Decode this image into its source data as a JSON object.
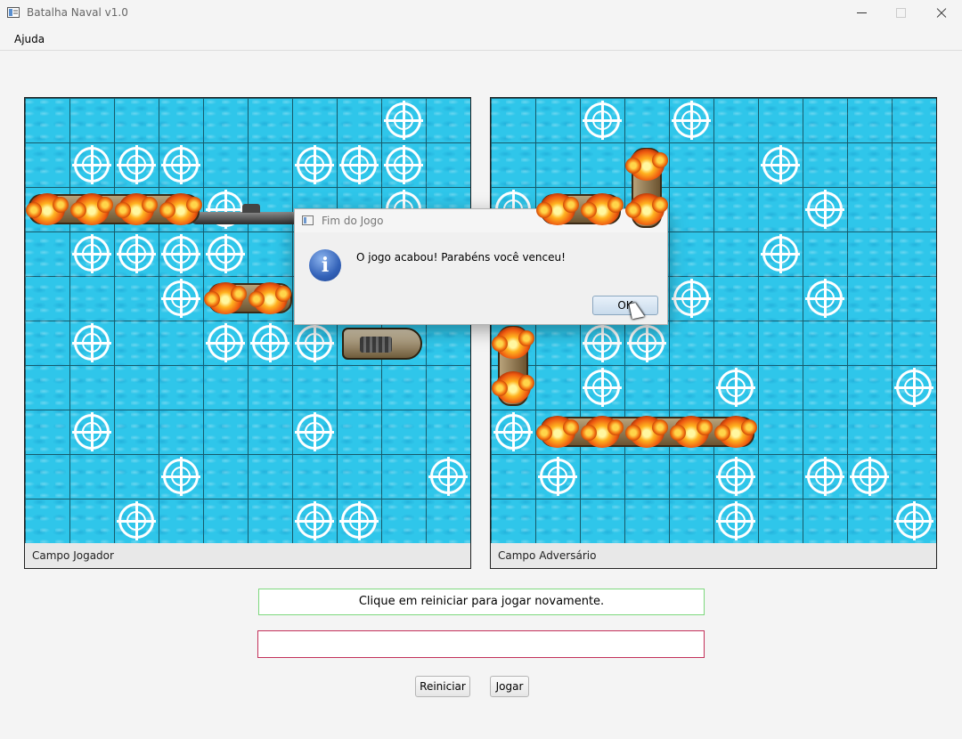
{
  "window": {
    "title": "Batalha Naval v1.0"
  },
  "menu": {
    "items": [
      "Ajuda"
    ]
  },
  "player_board": {
    "label": "Campo Jogador",
    "misses": [
      [
        0,
        8
      ],
      [
        1,
        1
      ],
      [
        1,
        2
      ],
      [
        1,
        3
      ],
      [
        1,
        6
      ],
      [
        1,
        7
      ],
      [
        1,
        8
      ],
      [
        2,
        4
      ],
      [
        2,
        8
      ],
      [
        3,
        1
      ],
      [
        3,
        2
      ],
      [
        3,
        3
      ],
      [
        3,
        4
      ],
      [
        4,
        3
      ],
      [
        5,
        1
      ],
      [
        5,
        4
      ],
      [
        5,
        5
      ],
      [
        5,
        6
      ],
      [
        7,
        1
      ],
      [
        7,
        6
      ],
      [
        8,
        3
      ],
      [
        8,
        9
      ],
      [
        9,
        2
      ],
      [
        9,
        6
      ],
      [
        9,
        7
      ]
    ],
    "hits": [
      [
        2,
        0
      ],
      [
        2,
        1
      ],
      [
        2,
        2
      ],
      [
        2,
        3
      ],
      [
        4,
        4
      ],
      [
        4,
        5
      ]
    ]
  },
  "opponent_board": {
    "label": "Campo Adversário",
    "misses": [
      [
        0,
        2
      ],
      [
        0,
        4
      ],
      [
        1,
        6
      ],
      [
        2,
        0
      ],
      [
        2,
        7
      ],
      [
        3,
        6
      ],
      [
        4,
        4
      ],
      [
        4,
        7
      ],
      [
        5,
        2
      ],
      [
        5,
        3
      ],
      [
        6,
        2
      ],
      [
        6,
        5
      ],
      [
        6,
        9
      ],
      [
        7,
        0
      ],
      [
        8,
        1
      ],
      [
        8,
        5
      ],
      [
        8,
        7
      ],
      [
        8,
        8
      ],
      [
        9,
        5
      ],
      [
        9,
        9
      ]
    ],
    "hits": [
      [
        1,
        3
      ],
      [
        2,
        1
      ],
      [
        2,
        2
      ],
      [
        2,
        3
      ],
      [
        5,
        0
      ],
      [
        6,
        0
      ],
      [
        7,
        1
      ],
      [
        7,
        2
      ],
      [
        7,
        3
      ],
      [
        7,
        4
      ],
      [
        7,
        5
      ]
    ]
  },
  "status_message": "Clique em reiniciar para jogar novamente.",
  "command_input": {
    "value": ""
  },
  "buttons": {
    "restart": "Reiniciar",
    "play": "Jogar"
  },
  "dialog": {
    "title": "Fim do Jogo",
    "message": "O jogo acabou! Parabéns você venceu!",
    "ok_label": "OK",
    "icon": "info-icon"
  }
}
